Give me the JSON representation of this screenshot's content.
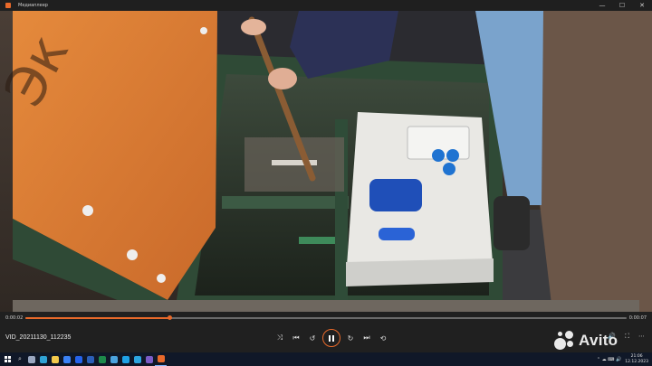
{
  "window": {
    "title": "Медиаплеер",
    "minimize_glyph": "—",
    "maximize_glyph": "☐",
    "close_glyph": "✕"
  },
  "player": {
    "file_name": "VID_20211130_112235",
    "time_current": "0:00:02",
    "time_total": "0:00:07",
    "progress_fraction": 0.24,
    "state": "playing",
    "accent_color": "#e8692a",
    "controls": [
      {
        "name": "shuffle-icon",
        "glyph": "⤨"
      },
      {
        "name": "previous-icon",
        "glyph": "⏮"
      },
      {
        "name": "rewind-10-icon",
        "glyph": "↺"
      },
      {
        "name": "pause-icon",
        "glyph": ""
      },
      {
        "name": "forward-30-icon",
        "glyph": "↻"
      },
      {
        "name": "next-icon",
        "glyph": "⏭"
      },
      {
        "name": "repeat-icon",
        "glyph": "⟲"
      }
    ],
    "right_controls": [
      {
        "name": "volume-icon",
        "glyph": "🔊"
      },
      {
        "name": "fullscreen-icon",
        "glyph": "⛶"
      },
      {
        "name": "more-icon",
        "glyph": "⋯"
      }
    ]
  },
  "watermark": {
    "brand": "Avito"
  },
  "taskbar": {
    "search_glyph": "⌕",
    "apps": [
      {
        "name": "taskview-icon",
        "color": "#9aa7c0"
      },
      {
        "name": "edge-icon",
        "color": "#2fa3d6"
      },
      {
        "name": "explorer-icon",
        "color": "#f2c94c"
      },
      {
        "name": "store-icon",
        "color": "#3b82f6"
      },
      {
        "name": "mail-icon",
        "color": "#2563eb"
      },
      {
        "name": "word-icon",
        "color": "#2b5fb8"
      },
      {
        "name": "excel-icon",
        "color": "#1d8a4b"
      },
      {
        "name": "photos-icon",
        "color": "#4aa3df"
      },
      {
        "name": "skype-icon",
        "color": "#1ea1e5"
      },
      {
        "name": "telegram-icon",
        "color": "#2ca5e0"
      },
      {
        "name": "viber-icon",
        "color": "#7b5cc7"
      },
      {
        "name": "media-player-icon",
        "color": "#e8692a"
      }
    ],
    "tray_glyphs": "⌃ ☁ ⌨ 🔊",
    "clock_time": "21:06",
    "clock_date": "12.12.2023"
  }
}
